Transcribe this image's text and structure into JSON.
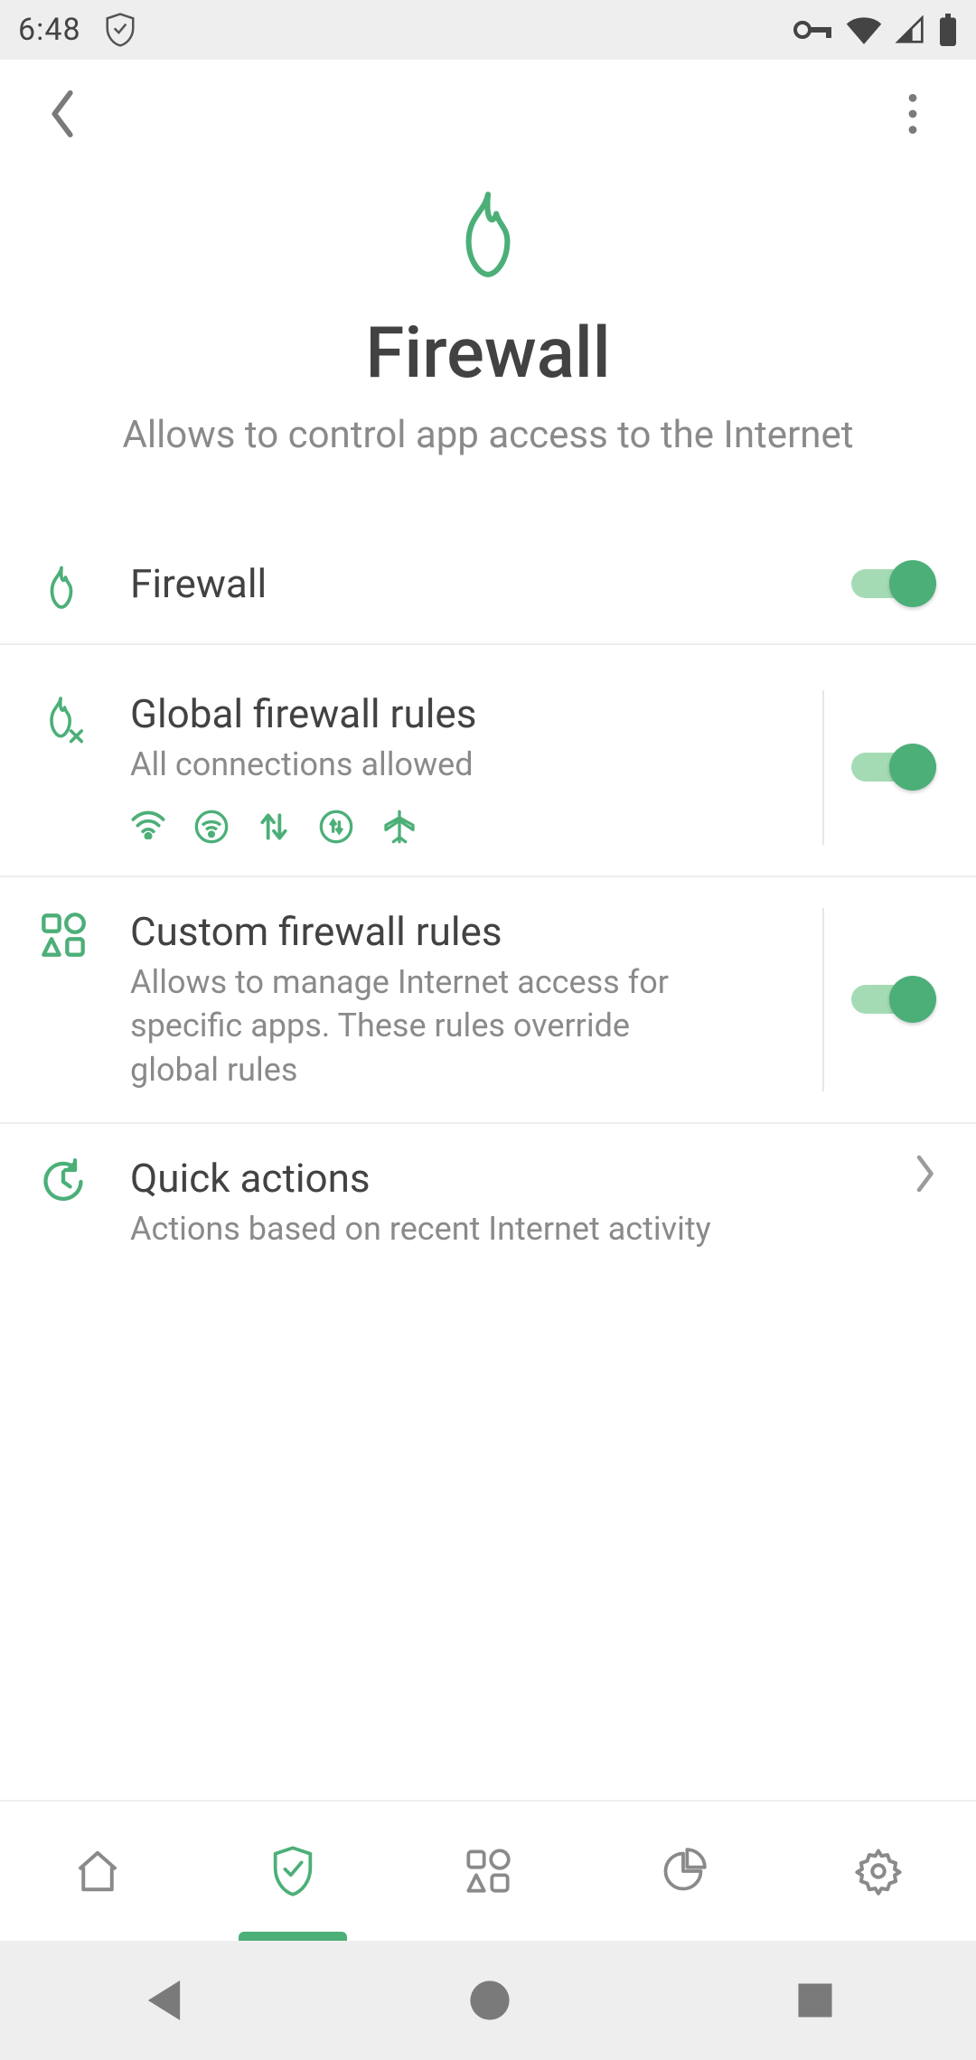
{
  "status": {
    "time": "6:48"
  },
  "header": {
    "title": "Firewall",
    "subtitle": "Allows to control app access to the Internet"
  },
  "rows": {
    "firewall": {
      "title": "Firewall",
      "enabled": true
    },
    "global": {
      "title": "Global firewall rules",
      "subtitle": "All connections allowed",
      "enabled": true
    },
    "custom": {
      "title": "Custom firewall rules",
      "subtitle": "Allows to manage Internet access for specific apps. These rules override global rules",
      "enabled": true
    },
    "quick": {
      "title": "Quick actions",
      "subtitle": "Actions based on recent Internet activity"
    }
  },
  "colors": {
    "accent": "#4caf78",
    "muted": "#8a8a8a",
    "text": "#424242"
  }
}
